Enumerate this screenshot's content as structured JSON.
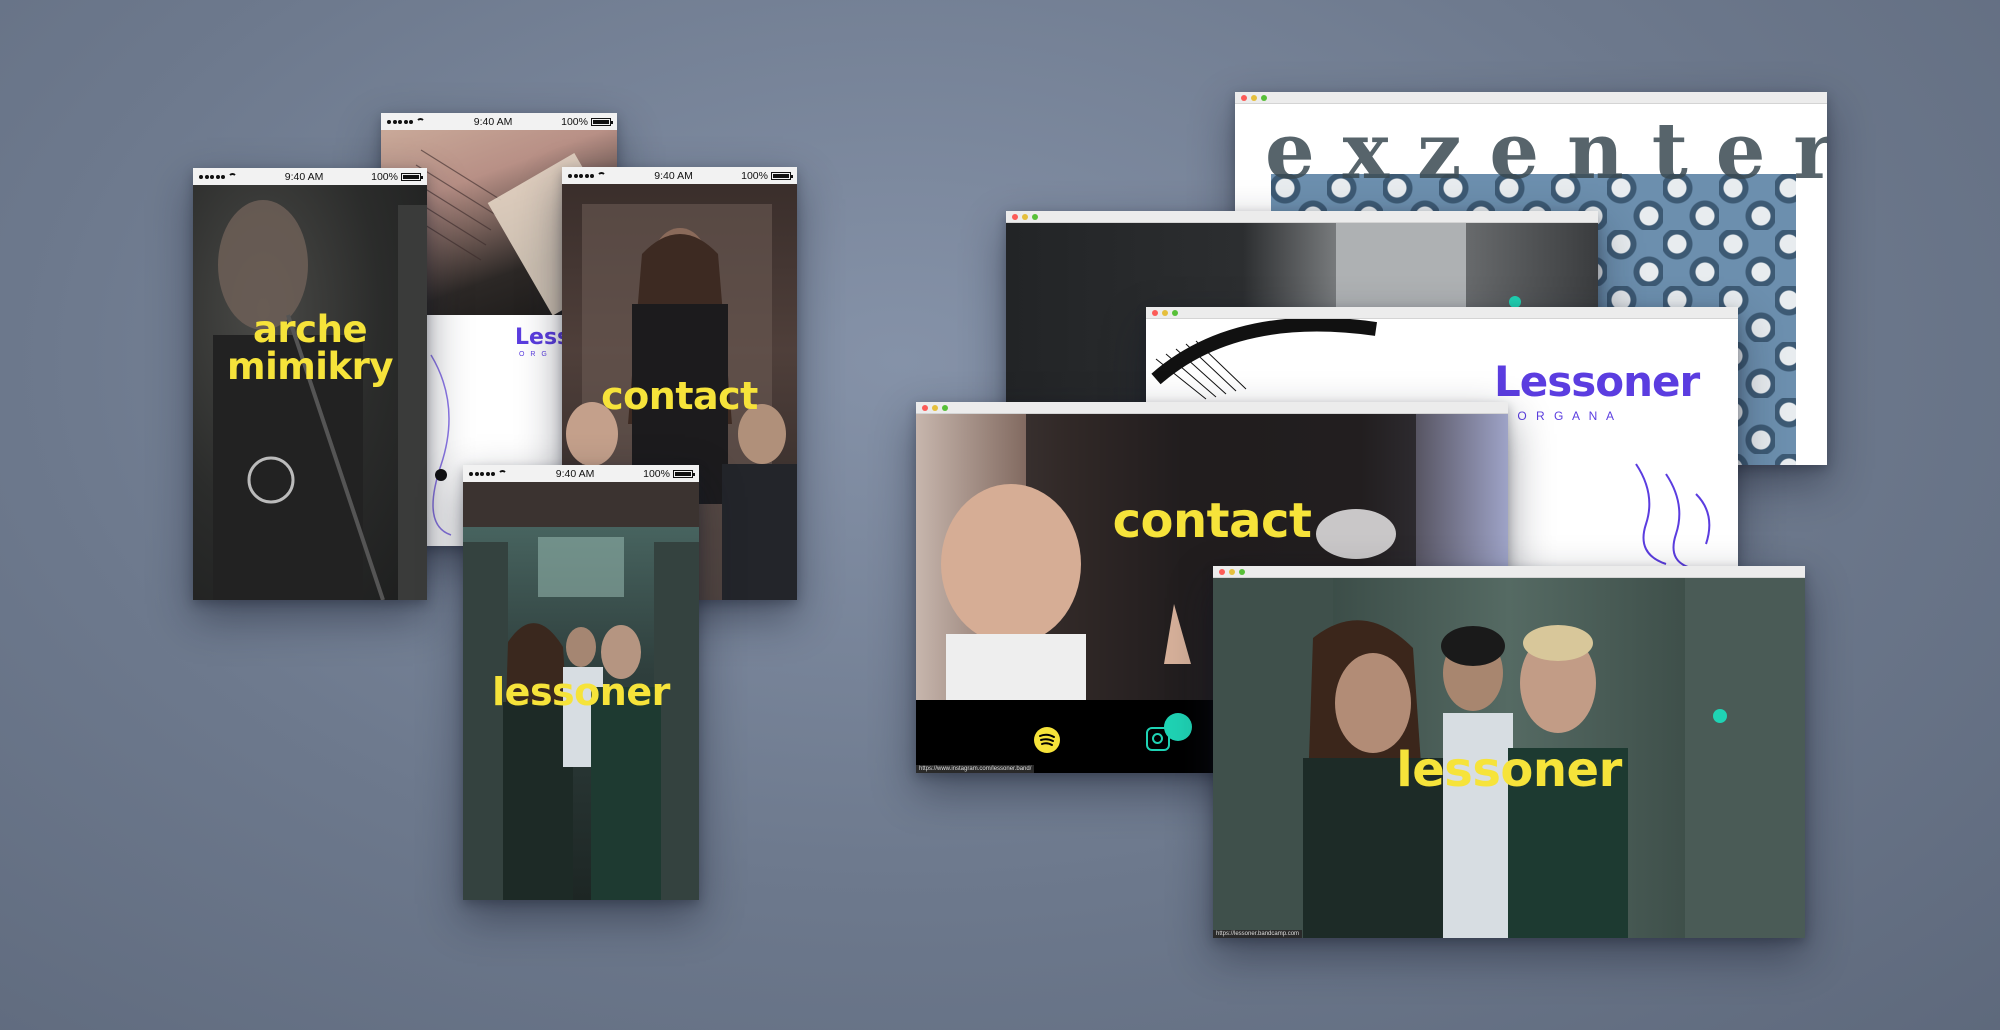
{
  "status": {
    "time": "9:40 AM",
    "battery": "100%"
  },
  "phones": {
    "arche": {
      "title_line1": "arche",
      "title_line2": "mimikry"
    },
    "notebook": {
      "brand": "Lessoner",
      "sub": "O R G"
    },
    "contact": {
      "title": "contact"
    },
    "lessoner": {
      "title": "lessoner"
    }
  },
  "browsers": {
    "exzenter": {
      "wordmark": "exzenter"
    },
    "morgana": {
      "brand": "Lessoner",
      "sub": "M O R G A N A"
    },
    "contact": {
      "title": "contact",
      "url": "https://www.instagram.com/lessoner.band/"
    },
    "lessoner": {
      "title": "lessoner",
      "url": "https://lessoner.bandcamp.com"
    }
  },
  "colors": {
    "accent_yellow": "#f6e33a",
    "brand_purple": "#5b3de0",
    "accent_teal": "#1fd3b4",
    "background": "#6d798d"
  }
}
